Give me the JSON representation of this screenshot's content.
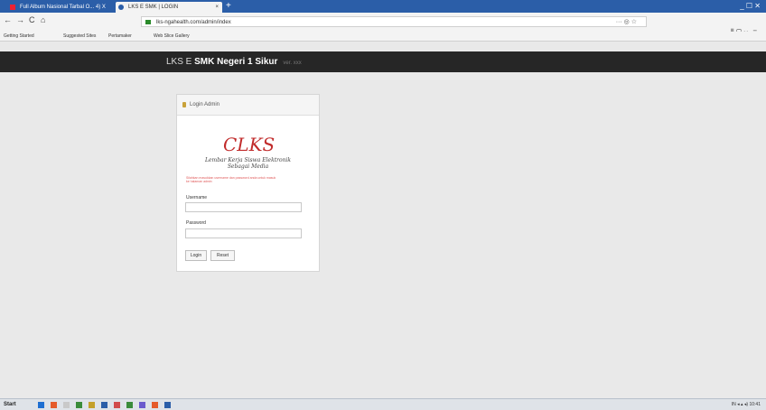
{
  "browser": {
    "tabs": [
      {
        "label": "Full Album Nasional Tarbal O... 4) X"
      },
      {
        "label": "LKS E SMK | LOGIN"
      }
    ],
    "new_tab_label": "+",
    "window_controls": "_ ☐ ✕",
    "back": "←",
    "forward": "→",
    "reload": "C",
    "home": "⌂",
    "url": "lks-ngahealth.com/admin/index",
    "url_actions": "··· ◎ ☆",
    "toolbar_right": "⫼ ▢ ≫ ≡",
    "bookmarks": [
      "Getting Started",
      "Suggested Sites",
      "Pertamaker",
      "Web Slice Gallery"
    ]
  },
  "site": {
    "brand": "LKS E SMK Negeri 1 Sikur",
    "brand_prefix": "LKS E ",
    "brand_name": "SMK Negeri 1 Sikur",
    "version": "ver. xxx"
  },
  "login": {
    "heading": "Login Admin",
    "logo_text": "CLKS",
    "tagline_line1": "Lembar Kerja Siswa Elektronik",
    "tagline_line2": "Sebagai Media",
    "warning": "Silahkan masukkan username dan password anda untuk masuk ke halaman admin",
    "username_label": "Username",
    "username_value": "",
    "password_label": "Password",
    "password_value": "",
    "login_button": "Login",
    "reset_button": "Reset"
  },
  "taskbar": {
    "start_label": "Start",
    "tray_text": "IN ◂ ▴ ◂) 10:41"
  },
  "colors": {
    "titlebar": "#2b5ea8",
    "header": "#262626",
    "page_bg": "#e9e9e9",
    "warning": "#e05a5a"
  }
}
